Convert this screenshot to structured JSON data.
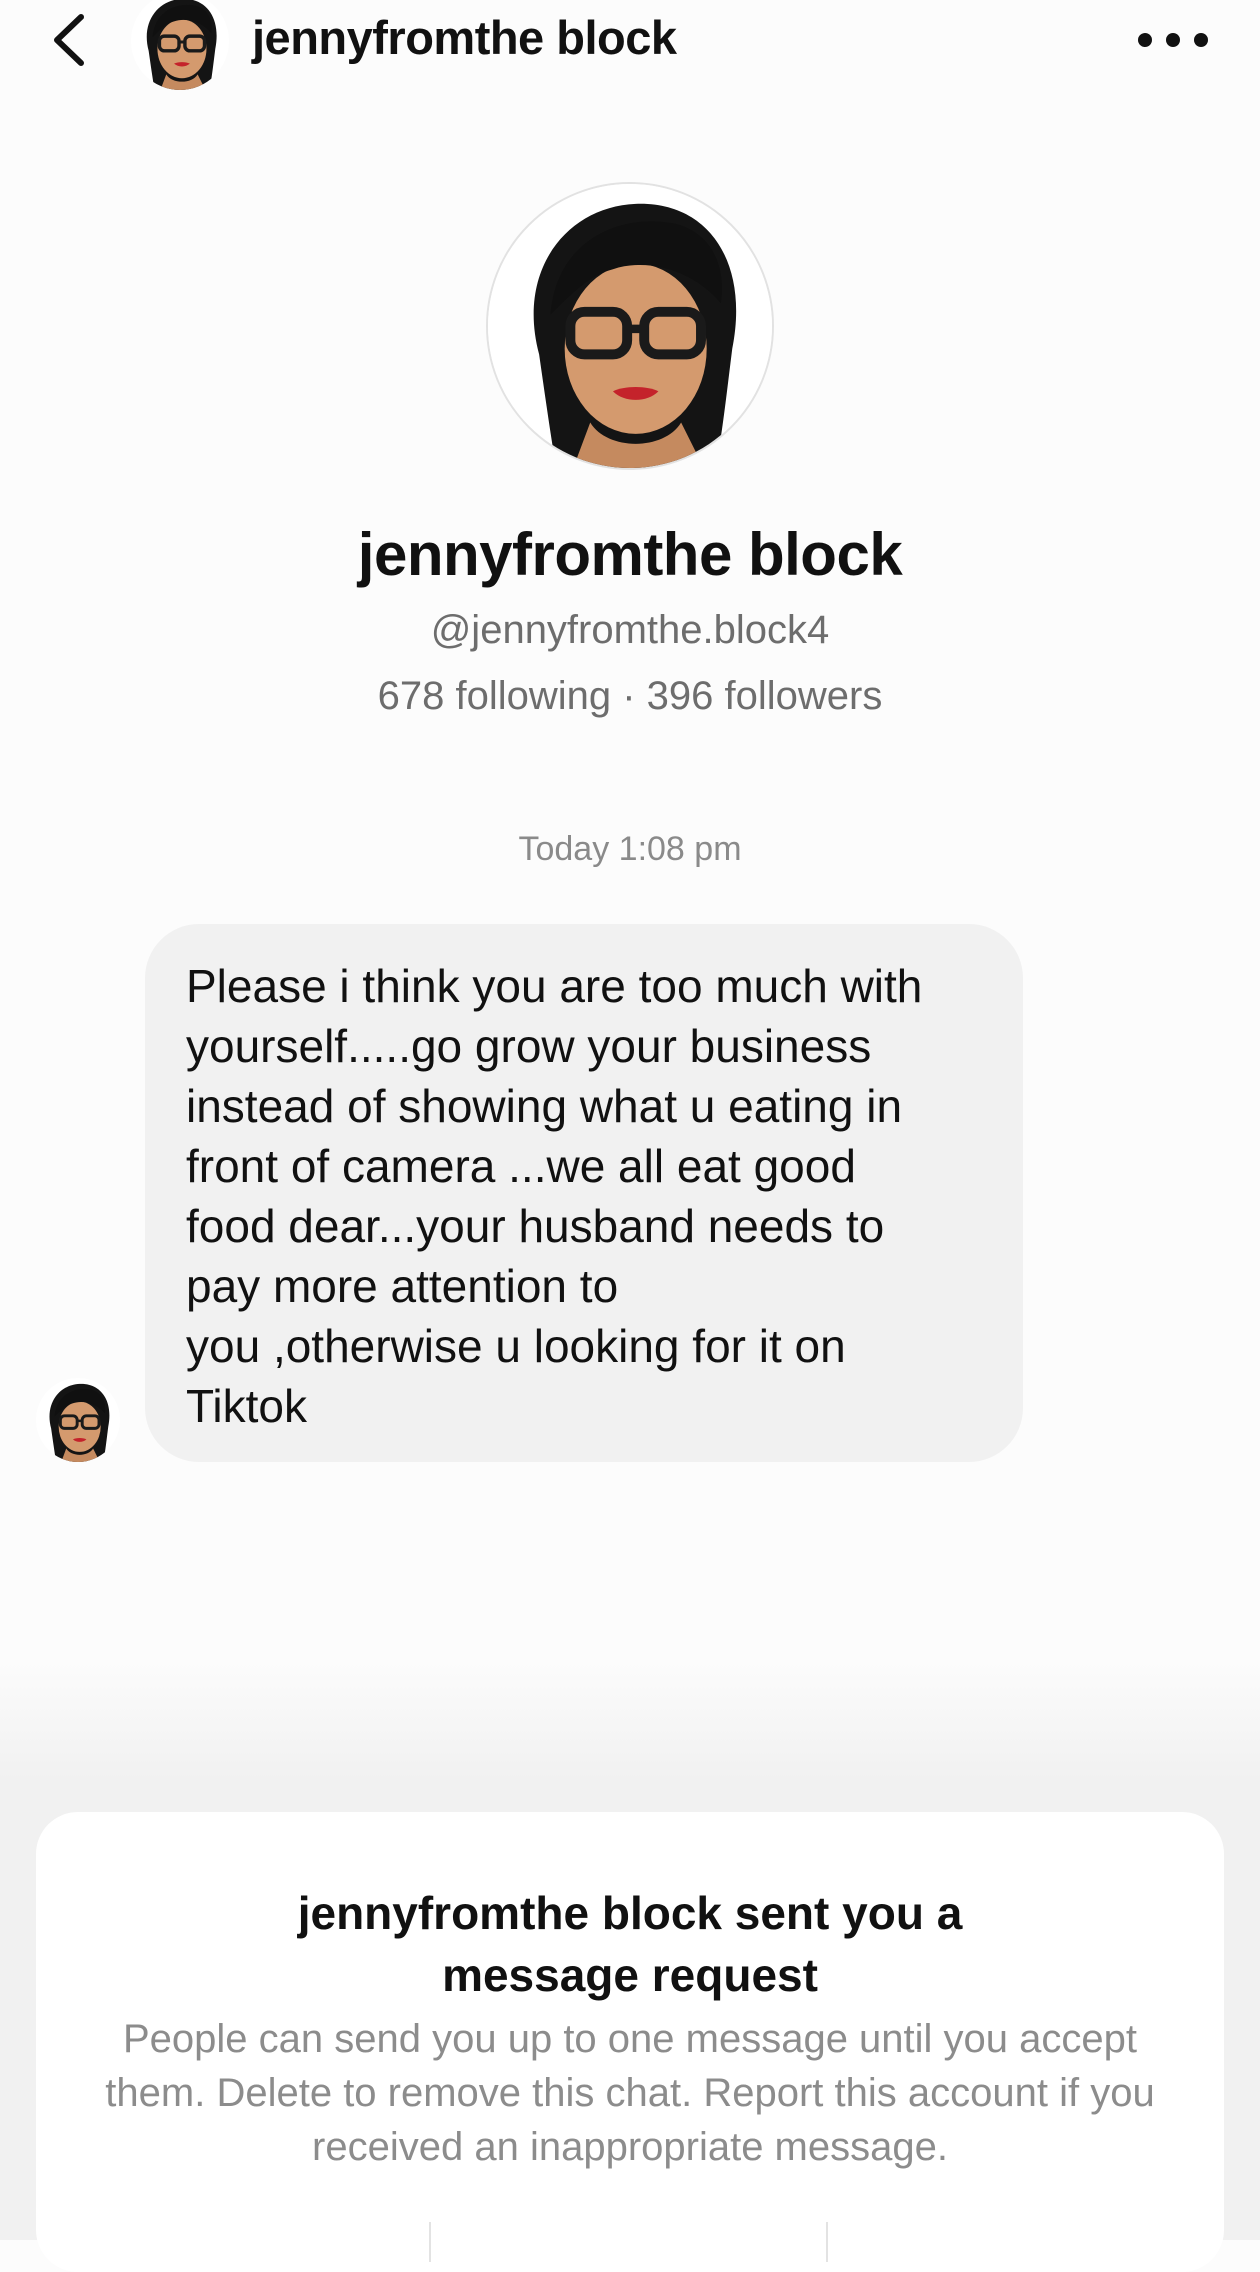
{
  "header": {
    "title": "jennyfromthe block"
  },
  "profile": {
    "display_name": "jennyfromthe block",
    "handle": "@jennyfromthe.block4",
    "stats": "678 following · 396 followers"
  },
  "conversation": {
    "timestamp": "Today 1:08 pm",
    "message": "Please i think you are too much with\nyourself.....go grow your business\ninstead of showing what u eating in\nfront of camera ...we all eat good\nfood dear...your husband needs to\npay more attention to\nyou ,otherwise u looking for it on\nTiktok"
  },
  "request_panel": {
    "title": "jennyfromthe block sent you a\nmessage request",
    "description": "People can send you up to one message until you accept them. Delete to remove this chat. Report this account if you received an inappropriate message."
  },
  "icons": {
    "back": "chevron-left-icon",
    "more": "more-horizontal-icon"
  },
  "colors": {
    "bubble": "#f1f1f1",
    "secondary_text": "#6d6d6d",
    "panel_background": "#ffffff"
  }
}
